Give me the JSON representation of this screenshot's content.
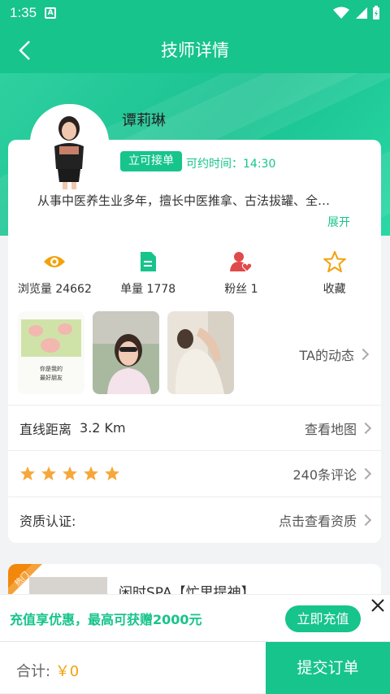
{
  "status": {
    "time": "1:35",
    "a_icon": "A"
  },
  "header": {
    "title": "技师详情"
  },
  "profile": {
    "name": "谭莉琳",
    "badge": "立可接单",
    "appoint_label": "可约时间：14:30",
    "desc": "从事中医养生业多年，擅长中医推拿、古法拔罐、全…",
    "expand": "展开"
  },
  "stats": [
    {
      "icon": "eye-icon",
      "label": "浏览量 24662"
    },
    {
      "icon": "document-icon",
      "label": "单量 1778"
    },
    {
      "icon": "fans-icon",
      "label": "粉丝 1"
    },
    {
      "icon": "star-outline-icon",
      "label": "收藏"
    }
  ],
  "dynamics": {
    "label": "TA的动态",
    "photo_caption_1": "你是我的",
    "photo_caption_2": "最好朋友"
  },
  "distance": {
    "label": "直线距离",
    "value": "3.2 Km",
    "link": "查看地图"
  },
  "rating": {
    "stars": 5,
    "reviews": "240条评论"
  },
  "cert": {
    "label": "资质认证:",
    "link": "点击查看资质"
  },
  "service": {
    "hot": "热门",
    "title": "闲时SPA【忙里提神】"
  },
  "promo": {
    "text": "充值享优惠，最高可获赠2000元",
    "button": "立即充值"
  },
  "bottom": {
    "total_label": "合计:",
    "amount": "￥0",
    "submit": "提交订单"
  },
  "colors": {
    "primary": "#17c48b",
    "orange": "#f2a20b",
    "red": "#d23a3a",
    "star": "#f7a73a"
  }
}
